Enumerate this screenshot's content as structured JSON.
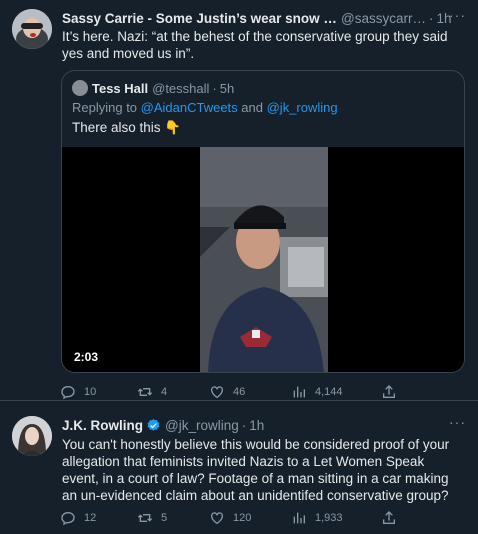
{
  "tweet1": {
    "author_name": "Sassy Carrie - Some Justin’s wear snow goggl…",
    "handle": "@sassycarr…",
    "time": "1h",
    "text": "It’s here. Nazi: “at the behest of the conservative group they said yes and moved us in”.",
    "more": "···",
    "quote": {
      "author_name": "Tess Hall",
      "handle": "@tesshall",
      "time": "5h",
      "replying_prefix": "Replying to ",
      "replying_to_1": "@AidanCTweets",
      "replying_and": " and ",
      "replying_to_2": "@jk_rowling",
      "text": "There also this",
      "emoji": "👇",
      "video_duration": "2:03"
    },
    "actions": {
      "replies": "10",
      "retweets": "4",
      "likes": "46",
      "views": "4,144"
    }
  },
  "tweet2": {
    "author_name": "J.K. Rowling",
    "handle": "@jk_rowling",
    "time": "1h",
    "text": "You can't honestly believe this would be considered proof of your allegation that feminists invited Nazis to a Let Women Speak event, in a court of law? Footage of a man sitting in a car making an un-evidenced claim about an unidentifed conservative group?",
    "more": "···",
    "actions": {
      "replies": "12",
      "retweets": "5",
      "likes": "120",
      "views": "1,933"
    }
  },
  "colors": {
    "background": "#15202b",
    "text": "#e7e9ea",
    "secondary": "#8b98a5",
    "link": "#1d9bf0",
    "border": "#38444d"
  }
}
